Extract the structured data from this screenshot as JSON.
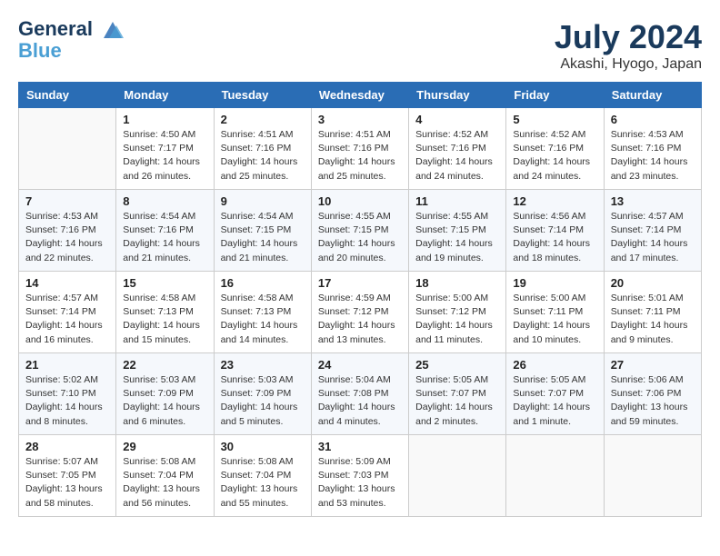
{
  "header": {
    "logo_line1": "General",
    "logo_line2": "Blue",
    "month": "July 2024",
    "location": "Akashi, Hyogo, Japan"
  },
  "weekdays": [
    "Sunday",
    "Monday",
    "Tuesday",
    "Wednesday",
    "Thursday",
    "Friday",
    "Saturday"
  ],
  "weeks": [
    [
      {
        "day": "",
        "empty": true
      },
      {
        "day": "1",
        "sunrise": "4:50 AM",
        "sunset": "7:17 PM",
        "daylight": "14 hours and 26 minutes."
      },
      {
        "day": "2",
        "sunrise": "4:51 AM",
        "sunset": "7:16 PM",
        "daylight": "14 hours and 25 minutes."
      },
      {
        "day": "3",
        "sunrise": "4:51 AM",
        "sunset": "7:16 PM",
        "daylight": "14 hours and 25 minutes."
      },
      {
        "day": "4",
        "sunrise": "4:52 AM",
        "sunset": "7:16 PM",
        "daylight": "14 hours and 24 minutes."
      },
      {
        "day": "5",
        "sunrise": "4:52 AM",
        "sunset": "7:16 PM",
        "daylight": "14 hours and 24 minutes."
      },
      {
        "day": "6",
        "sunrise": "4:53 AM",
        "sunset": "7:16 PM",
        "daylight": "14 hours and 23 minutes."
      }
    ],
    [
      {
        "day": "7",
        "sunrise": "4:53 AM",
        "sunset": "7:16 PM",
        "daylight": "14 hours and 22 minutes."
      },
      {
        "day": "8",
        "sunrise": "4:54 AM",
        "sunset": "7:16 PM",
        "daylight": "14 hours and 21 minutes."
      },
      {
        "day": "9",
        "sunrise": "4:54 AM",
        "sunset": "7:15 PM",
        "daylight": "14 hours and 21 minutes."
      },
      {
        "day": "10",
        "sunrise": "4:55 AM",
        "sunset": "7:15 PM",
        "daylight": "14 hours and 20 minutes."
      },
      {
        "day": "11",
        "sunrise": "4:55 AM",
        "sunset": "7:15 PM",
        "daylight": "14 hours and 19 minutes."
      },
      {
        "day": "12",
        "sunrise": "4:56 AM",
        "sunset": "7:14 PM",
        "daylight": "14 hours and 18 minutes."
      },
      {
        "day": "13",
        "sunrise": "4:57 AM",
        "sunset": "7:14 PM",
        "daylight": "14 hours and 17 minutes."
      }
    ],
    [
      {
        "day": "14",
        "sunrise": "4:57 AM",
        "sunset": "7:14 PM",
        "daylight": "14 hours and 16 minutes."
      },
      {
        "day": "15",
        "sunrise": "4:58 AM",
        "sunset": "7:13 PM",
        "daylight": "14 hours and 15 minutes."
      },
      {
        "day": "16",
        "sunrise": "4:58 AM",
        "sunset": "7:13 PM",
        "daylight": "14 hours and 14 minutes."
      },
      {
        "day": "17",
        "sunrise": "4:59 AM",
        "sunset": "7:12 PM",
        "daylight": "14 hours and 13 minutes."
      },
      {
        "day": "18",
        "sunrise": "5:00 AM",
        "sunset": "7:12 PM",
        "daylight": "14 hours and 11 minutes."
      },
      {
        "day": "19",
        "sunrise": "5:00 AM",
        "sunset": "7:11 PM",
        "daylight": "14 hours and 10 minutes."
      },
      {
        "day": "20",
        "sunrise": "5:01 AM",
        "sunset": "7:11 PM",
        "daylight": "14 hours and 9 minutes."
      }
    ],
    [
      {
        "day": "21",
        "sunrise": "5:02 AM",
        "sunset": "7:10 PM",
        "daylight": "14 hours and 8 minutes."
      },
      {
        "day": "22",
        "sunrise": "5:03 AM",
        "sunset": "7:09 PM",
        "daylight": "14 hours and 6 minutes."
      },
      {
        "day": "23",
        "sunrise": "5:03 AM",
        "sunset": "7:09 PM",
        "daylight": "14 hours and 5 minutes."
      },
      {
        "day": "24",
        "sunrise": "5:04 AM",
        "sunset": "7:08 PM",
        "daylight": "14 hours and 4 minutes."
      },
      {
        "day": "25",
        "sunrise": "5:05 AM",
        "sunset": "7:07 PM",
        "daylight": "14 hours and 2 minutes."
      },
      {
        "day": "26",
        "sunrise": "5:05 AM",
        "sunset": "7:07 PM",
        "daylight": "14 hours and 1 minute."
      },
      {
        "day": "27",
        "sunrise": "5:06 AM",
        "sunset": "7:06 PM",
        "daylight": "13 hours and 59 minutes."
      }
    ],
    [
      {
        "day": "28",
        "sunrise": "5:07 AM",
        "sunset": "7:05 PM",
        "daylight": "13 hours and 58 minutes."
      },
      {
        "day": "29",
        "sunrise": "5:08 AM",
        "sunset": "7:04 PM",
        "daylight": "13 hours and 56 minutes."
      },
      {
        "day": "30",
        "sunrise": "5:08 AM",
        "sunset": "7:04 PM",
        "daylight": "13 hours and 55 minutes."
      },
      {
        "day": "31",
        "sunrise": "5:09 AM",
        "sunset": "7:03 PM",
        "daylight": "13 hours and 53 minutes."
      },
      {
        "day": "",
        "empty": true
      },
      {
        "day": "",
        "empty": true
      },
      {
        "day": "",
        "empty": true
      }
    ]
  ]
}
